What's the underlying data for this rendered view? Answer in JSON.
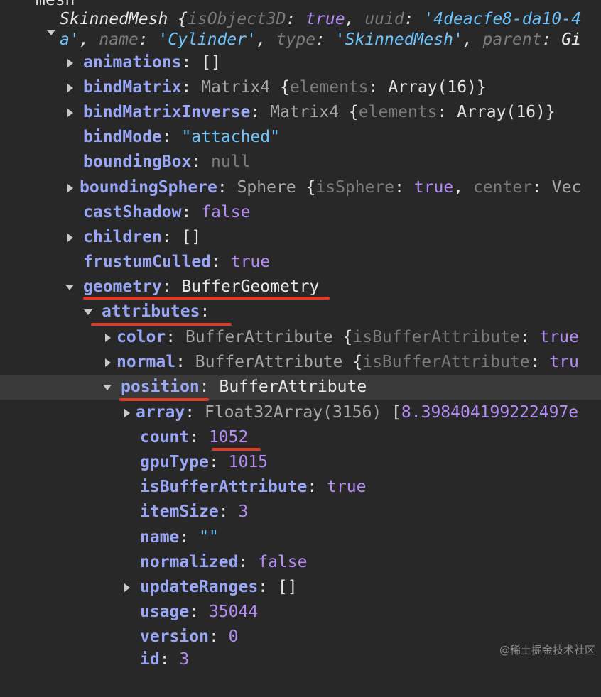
{
  "header": {
    "label": "mesh"
  },
  "summary": {
    "line1": {
      "class": "SkinnedMesh",
      "open": " {",
      "k1": "isObject3D",
      "v1": "true",
      "k2": "uuid",
      "v2": "'4deacfe8-da10-4"
    },
    "line2": {
      "v_a": "a'",
      "k_name": "name",
      "v_name": "'Cylinder'",
      "k_type": "type",
      "v_type": "'SkinnedMesh'",
      "k_parent": "parent",
      "v_parent": "Gi"
    }
  },
  "props": {
    "animations": {
      "key": "animations",
      "value": "[]"
    },
    "bindMatrix": {
      "key": "bindMatrix",
      "cls": "Matrix4",
      "open": " {",
      "k": "elements",
      "v": "Array(16)",
      "close": "}"
    },
    "bindMatrixInverse": {
      "key": "bindMatrixInverse",
      "cls": "Matrix4",
      "open": " {",
      "k": "elements",
      "v": "Array(16)",
      "close": "}"
    },
    "bindMode": {
      "key": "bindMode",
      "value": "\"attached\""
    },
    "boundingBox": {
      "key": "boundingBox",
      "value": "null"
    },
    "boundingSphere": {
      "key": "boundingSphere",
      "cls": "Sphere",
      "open": " {",
      "k1": "isSphere",
      "v1": "true",
      "k2": "center",
      "v2": "Vec"
    },
    "castShadow": {
      "key": "castShadow",
      "value": "false"
    },
    "children": {
      "key": "children",
      "value": "[]"
    },
    "frustumCulled": {
      "key": "frustumCulled",
      "value": "true"
    },
    "geometry": {
      "key": "geometry",
      "value": "BufferGeometry"
    },
    "attributes": {
      "key": "attributes"
    },
    "color": {
      "key": "color",
      "cls": "BufferAttribute",
      "open": " {",
      "k": "isBufferAttribute",
      "v": "true"
    },
    "normal": {
      "key": "normal",
      "cls": "BufferAttribute",
      "open": " {",
      "k": "isBufferAttribute",
      "v": "tru"
    },
    "position": {
      "key": "position",
      "value": "BufferAttribute"
    },
    "array": {
      "key": "array",
      "cls": "Float32Array(3156)",
      "open": " [",
      "v": "8.398404199222497e"
    },
    "count": {
      "key": "count",
      "value": "1052"
    },
    "gpuType": {
      "key": "gpuType",
      "value": "1015"
    },
    "isBufferAttribute": {
      "key": "isBufferAttribute",
      "value": "true"
    },
    "itemSize": {
      "key": "itemSize",
      "value": "3"
    },
    "name": {
      "key": "name",
      "value": "\"\""
    },
    "normalized": {
      "key": "normalized",
      "value": "false"
    },
    "updateRanges": {
      "key": "updateRanges",
      "value": "[]"
    },
    "usage": {
      "key": "usage",
      "value": "35044"
    },
    "version": {
      "key": "version",
      "value": "0"
    },
    "id": {
      "key": "id",
      "value": "3"
    }
  },
  "watermark": "@稀土掘金技术社区",
  "colors": {
    "background": "#282828",
    "highlight_row": "#3a3a3a",
    "key": "#9aa6f7",
    "string": "#6ec5ff",
    "number_boolean": "#b38cf5",
    "underline": "#e23a26"
  },
  "icons": {
    "collapsed": "triangle-right-icon",
    "expanded": "triangle-down-icon"
  }
}
